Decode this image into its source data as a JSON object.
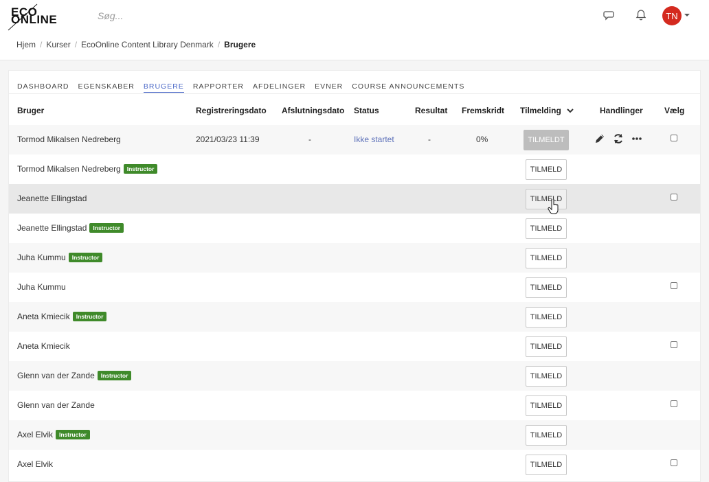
{
  "header": {
    "logo_line1": "ECO",
    "logo_line2": "ONLINE",
    "search_placeholder": "Søg...",
    "avatar_initials": "TN",
    "icons": [
      "chat-icon",
      "bell-icon"
    ]
  },
  "breadcrumb": {
    "items": [
      "Hjem",
      "Kurser",
      "EcoOnline Content Library Denmark"
    ],
    "current": "Brugere"
  },
  "tabs": [
    "DASHBOARD",
    "EGENSKABER",
    "BRUGERE",
    "RAPPORTER",
    "AFDELINGER",
    "EVNER",
    "COURSE ANNOUNCEMENTS"
  ],
  "active_tab": "BRUGERE",
  "table": {
    "headers": {
      "user": "Bruger",
      "registered": "Registreringsdato",
      "completed": "Afslutningsdato",
      "status": "Status",
      "result": "Resultat",
      "progress": "Fremskridt",
      "enrollment": "Tilmelding",
      "actions": "Handlinger",
      "select": "Vælg"
    },
    "first_row": {
      "name": "Tormod Mikalsen Nedreberg",
      "registered": "2021/03/23 11:39",
      "completed": "-",
      "status": "Ikke startet",
      "result": "-",
      "progress": "0%",
      "button": "TILMELDT"
    },
    "instructor_badge": "Instructor",
    "enroll_label": "TILMELD",
    "rows": [
      {
        "name": "Tormod Mikalsen Nedreberg",
        "instructor": true,
        "checkbox": false
      },
      {
        "name": "Jeanette Ellingstad",
        "instructor": false,
        "checkbox": true
      },
      {
        "name": "Jeanette Ellingstad",
        "instructor": true,
        "checkbox": false
      },
      {
        "name": "Juha Kummu",
        "instructor": true,
        "checkbox": false
      },
      {
        "name": "Juha Kummu",
        "instructor": false,
        "checkbox": true
      },
      {
        "name": "Aneta Kmiecik",
        "instructor": true,
        "checkbox": false
      },
      {
        "name": "Aneta Kmiecik",
        "instructor": false,
        "checkbox": true
      },
      {
        "name": "Glenn van der Zande",
        "instructor": true,
        "checkbox": false
      },
      {
        "name": "Glenn van der Zande",
        "instructor": false,
        "checkbox": true
      },
      {
        "name": "Axel Elvik",
        "instructor": true,
        "checkbox": false
      },
      {
        "name": "Axel Elvik",
        "instructor": false,
        "checkbox": true
      }
    ]
  }
}
